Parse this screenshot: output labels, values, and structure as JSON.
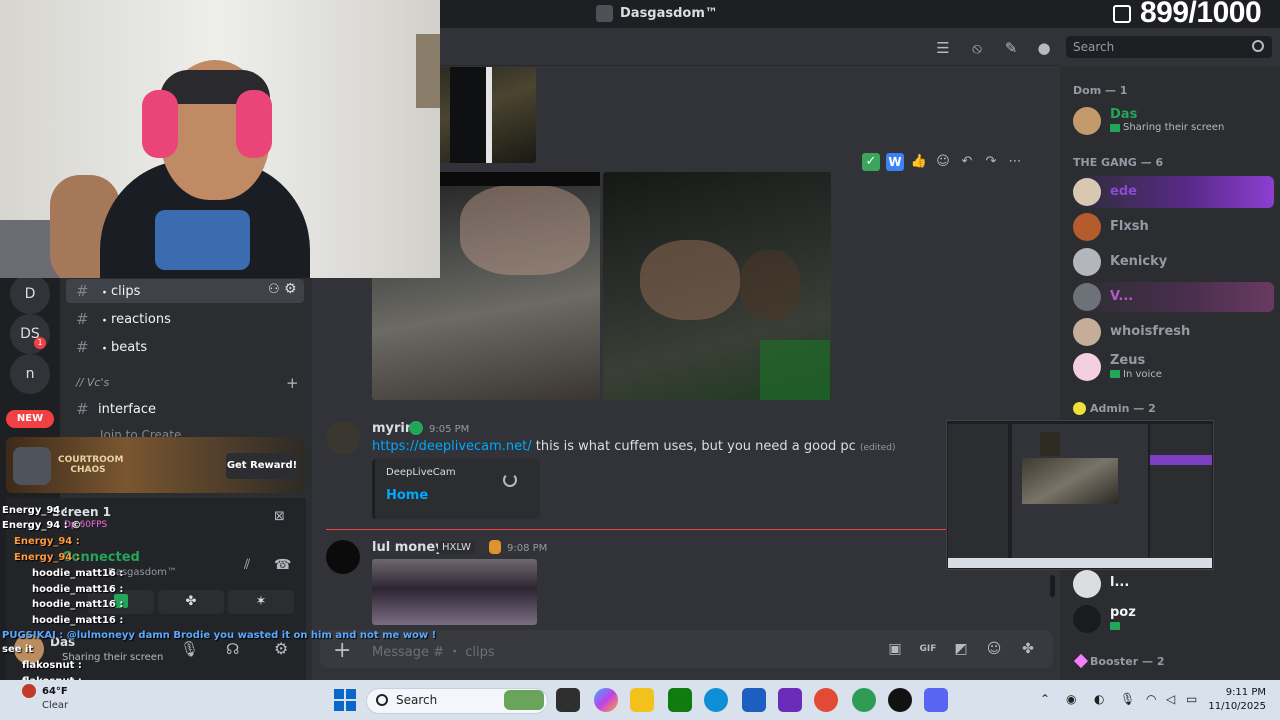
{
  "window": {
    "title": "Dasgasdom™"
  },
  "overlay": {
    "counter": "899/1000"
  },
  "search": {
    "placeholder": "Search"
  },
  "channels": {
    "items": [
      {
        "name": "clips"
      },
      {
        "name": "reactions"
      },
      {
        "name": "beats"
      }
    ],
    "category": "// Vc's",
    "interface": "interface",
    "join": "Join to Create"
  },
  "rail": {
    "d": "D",
    "ds": "DS",
    "n": "n",
    "ds_badge": "1",
    "new_label": "NEW"
  },
  "promo": {
    "title": "COURTROOM CHAOS",
    "button": "Get Reward!"
  },
  "voice": {
    "screen_label": "Screen 1",
    "quality": "Dp 60FPS",
    "connected": "Connected",
    "channel": "Dasgasdom™"
  },
  "user_bar": {
    "name": "Das",
    "status": "Sharing their screen"
  },
  "chat_overlay": [
    "Energy_94 :",
    "Energy_94 : ©",
    "Energy_94 :",
    "Energy_94 :",
    "hoodie_matt16 :",
    "hoodie_matt16 :",
    "hoodie_matt16 :",
    "hoodie_matt16 :",
    "PUGSIKAI : @lulmoneyy damn Brodie you wasted it on him and not me wow !",
    "see it",
    "flakosnut :",
    "flakosnut :",
    "64°F",
    "Clear"
  ],
  "messages": [
    {
      "author": "myrin",
      "time": "9:05 PM",
      "link": "https://deeplivecam.net/",
      "text": "this is what cuffem uses, but you need a good pc",
      "edited": "(edited)",
      "embed_site": "DeepLiveCam",
      "embed_title": "Home",
      "author_color": "#3ba55c"
    },
    {
      "author": "lul moneyy",
      "badge": "HXLW",
      "time": "9:08 PM",
      "author_color": "#e0932c"
    }
  ],
  "composer": {
    "placeholder": "Message # ・ clips"
  },
  "members": {
    "dom_header": "Dom — 1",
    "dom": [
      {
        "name": "Das",
        "status": "Sharing their screen"
      }
    ],
    "gang_header": "THE GANG — 6",
    "gang": [
      {
        "name": "ede"
      },
      {
        "name": "Flxsh"
      },
      {
        "name": "Kenicky"
      },
      {
        "name": "V..."
      },
      {
        "name": "whoisfresh"
      },
      {
        "name": "Zeus",
        "status": "In voice"
      }
    ],
    "admin_header": "Admin — 2",
    "admins": [
      {
        "name": "l..."
      },
      {
        "name": "poz"
      }
    ],
    "booster_header": "Booster — 2"
  },
  "taskbar": {
    "search": "Search",
    "time": "9:11 PM",
    "date": "11/10/2025"
  },
  "colors": {
    "accent_green": "#23a55a",
    "link": "#00a8fc",
    "danger": "#f23f43",
    "background": "#313338"
  }
}
